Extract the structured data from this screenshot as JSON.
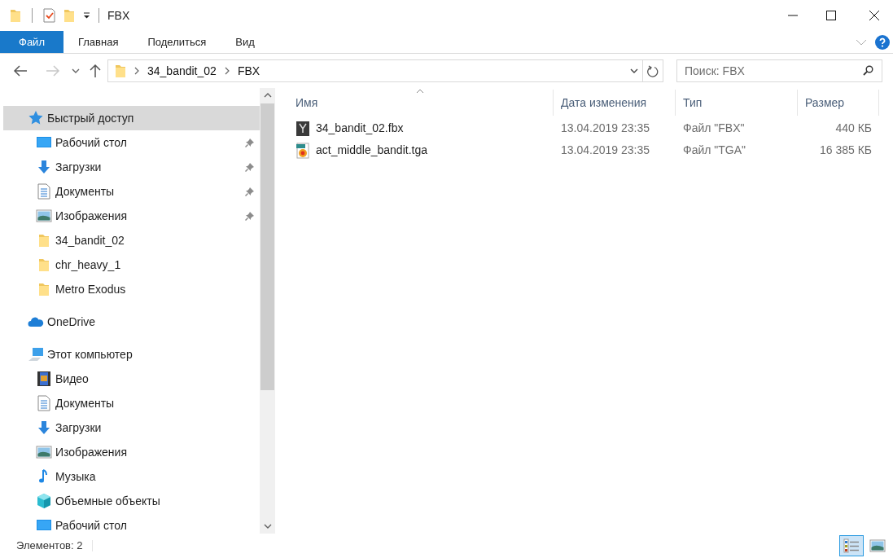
{
  "window": {
    "title": "FBX"
  },
  "ribbon": {
    "tabs": [
      {
        "label": "Файл",
        "selected": true
      },
      {
        "label": "Главная",
        "selected": false
      },
      {
        "label": "Поделиться",
        "selected": false
      },
      {
        "label": "Вид",
        "selected": false
      }
    ]
  },
  "address_bar": {
    "crumbs": [
      "34_bandit_02",
      "FBX"
    ],
    "search": {
      "placeholder": "Поиск: FBX"
    }
  },
  "sidebar": {
    "items": [
      {
        "label": "Быстрый доступ",
        "kind": "star",
        "selected": true,
        "children": [
          {
            "label": "Рабочий стол",
            "kind": "desktop",
            "pinned": true,
            "selected": false
          },
          {
            "label": "Загрузки",
            "kind": "download",
            "pinned": true,
            "selected": false
          },
          {
            "label": "Документы",
            "kind": "document",
            "pinned": true,
            "selected": false
          },
          {
            "label": "Изображения",
            "kind": "pictures",
            "pinned": true,
            "selected": false
          },
          {
            "label": "34_bandit_02",
            "kind": "folder",
            "pinned": false,
            "selected": false
          },
          {
            "label": "chr_heavy_1",
            "kind": "folder",
            "pinned": false,
            "selected": false
          },
          {
            "label": "Metro Exodus",
            "kind": "folder",
            "pinned": false,
            "selected": false
          }
        ]
      },
      {
        "label": "OneDrive",
        "kind": "cloud",
        "selected": false
      },
      {
        "label": "Этот компьютер",
        "kind": "computer",
        "selected": false,
        "children": [
          {
            "label": "Видео",
            "kind": "video",
            "pinned": false,
            "selected": false
          },
          {
            "label": "Документы",
            "kind": "document",
            "pinned": false,
            "selected": false
          },
          {
            "label": "Загрузки",
            "kind": "download",
            "pinned": false,
            "selected": false
          },
          {
            "label": "Изображения",
            "kind": "pictures",
            "pinned": false,
            "selected": false
          },
          {
            "label": "Музыка",
            "kind": "music",
            "pinned": false,
            "selected": false
          },
          {
            "label": "Объемные объекты",
            "kind": "cube",
            "pinned": false,
            "selected": false
          },
          {
            "label": "Рабочий стол",
            "kind": "desktop",
            "pinned": false,
            "selected": false
          }
        ]
      }
    ]
  },
  "file_list": {
    "columns": [
      "Имя",
      "Дата изменения",
      "Тип",
      "Размер"
    ],
    "rows": [
      {
        "name": "34_bandit_02.fbx",
        "kind": "fbx",
        "modified": "13.04.2019 23:35",
        "type": "Файл \"FBX\"",
        "size": "440 КБ"
      },
      {
        "name": "act_middle_bandit.tga",
        "kind": "tga",
        "modified": "13.04.2019 23:35",
        "type": "Файл \"TGA\"",
        "size": "16 385 КБ"
      }
    ]
  },
  "status_bar": {
    "text": "Элементов: 2",
    "views": [
      {
        "kind": "details",
        "selected": true
      },
      {
        "kind": "large_icons",
        "selected": false
      }
    ]
  }
}
